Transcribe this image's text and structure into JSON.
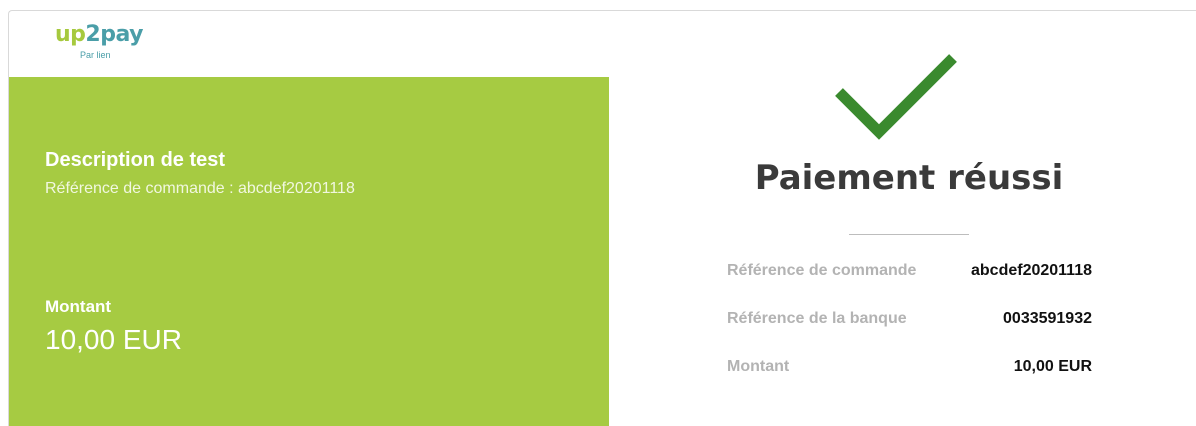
{
  "header": {
    "logo": {
      "main_up": "up",
      "main_rest": "2pay",
      "subtitle": "Par lien"
    }
  },
  "order": {
    "description": "Description de test",
    "reference_line": "Référence de commande : abcdef20201118",
    "amount_label": "Montant",
    "amount_value": "10,00 EUR"
  },
  "result": {
    "icon": "checkmark-icon",
    "title": "Paiement réussi",
    "details": [
      {
        "label": "Référence de commande",
        "value": "abcdef20201118"
      },
      {
        "label": "Référence de la banque",
        "value": "0033591932"
      },
      {
        "label": "Montant",
        "value": "10,00 EUR"
      }
    ]
  },
  "colors": {
    "panel_green": "#a6cb42",
    "check_green": "#3a8a2e",
    "logo_green": "#a6c93e",
    "logo_teal": "#4a9ea8"
  }
}
